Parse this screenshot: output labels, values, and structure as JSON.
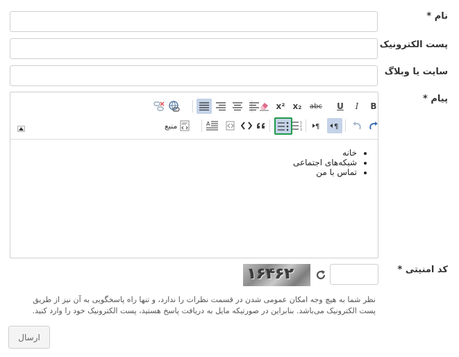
{
  "form": {
    "name_label": "نام",
    "email_label": "پست الکترونیک",
    "website_label": "سایت یا وبلاگ",
    "message_label": "پیام",
    "captcha_label": "کد امنیتی",
    "required_mark": "*",
    "name_value": "",
    "email_value": "",
    "website_value": "",
    "captcha_value": "",
    "submit_label": "ارسال"
  },
  "editor": {
    "toolbar_row1": [
      {
        "name": "bold",
        "label": "B"
      },
      {
        "name": "italic",
        "label": "I"
      },
      {
        "name": "underline",
        "label": "U"
      },
      {
        "name": "strikethrough",
        "label": "abc"
      },
      {
        "name": "subscript",
        "label": "x₂"
      },
      {
        "name": "superscript",
        "label": "x²"
      },
      {
        "name": "remove-format",
        "icon": "eraser-icon"
      },
      {
        "name": "align-left",
        "icon": "align-left-icon"
      },
      {
        "name": "align-center",
        "icon": "align-center-icon"
      },
      {
        "name": "align-right",
        "icon": "align-right-icon"
      },
      {
        "name": "align-justify",
        "icon": "align-justify-icon"
      },
      {
        "name": "link",
        "icon": "link-icon"
      },
      {
        "name": "unlink",
        "icon": "unlink-icon"
      }
    ],
    "toolbar_row2": [
      {
        "name": "redo",
        "icon": "redo-icon"
      },
      {
        "name": "undo",
        "icon": "undo-icon"
      },
      {
        "name": "rtl",
        "icon": "rtl-paragraph-icon"
      },
      {
        "name": "ltr",
        "icon": "ltr-paragraph-icon"
      },
      {
        "name": "numbered-list",
        "icon": "numbered-list-icon"
      },
      {
        "name": "bulleted-list",
        "icon": "bulleted-list-icon"
      },
      {
        "name": "blockquote",
        "label": "99"
      },
      {
        "name": "code",
        "icon": "code-icon"
      },
      {
        "name": "insert-code",
        "icon": "code-block-icon"
      },
      {
        "name": "text-direction",
        "icon": "text-direction-icon"
      },
      {
        "name": "source",
        "label": "منبع"
      }
    ],
    "source_label": "منبع",
    "content_items": [
      "خانه",
      "شبکه‌های اجتماعی",
      "تماس با من"
    ]
  },
  "captcha": {
    "text": "۱۶۴۶۲"
  },
  "note": "نظر شما به هیچ وجه امکان عمومی شدن در قسمت نظرات را ندارد، و تنها راه پاسخگویی به آن نیز از طریق پست الکترونیک می‌باشد. بنابراین در صورتیکه مایل به دریافت پاسخ هستید، پست الکترونیک خود را وارد کنید."
}
